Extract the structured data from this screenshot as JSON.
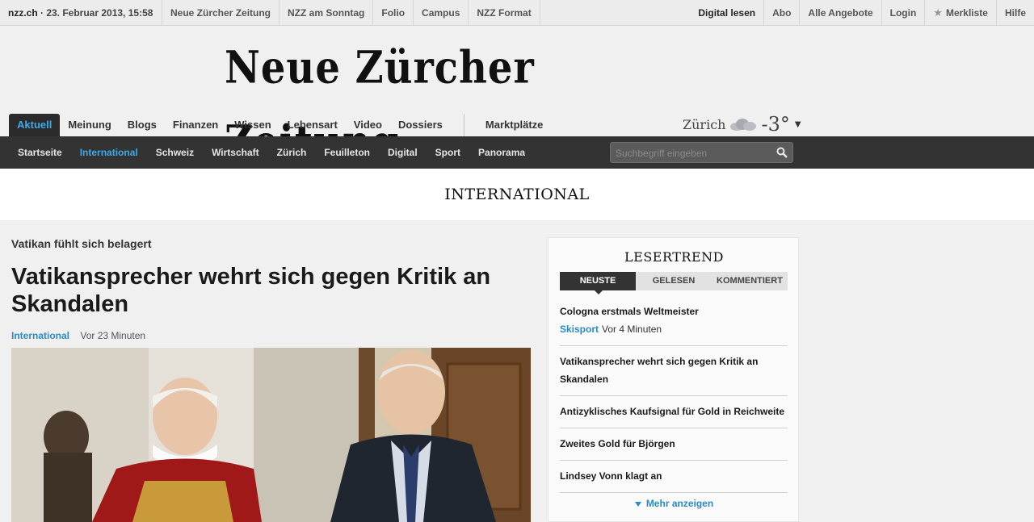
{
  "topbar": {
    "site": "nzz.ch",
    "date": " · 23. Februar 2013, 15:58",
    "links": [
      "Neue Zürcher Zeitung",
      "NZZ am Sonntag",
      "Folio",
      "Campus",
      "NZZ Format"
    ],
    "right_links": [
      "Digital lesen",
      "Abo",
      "Alle Angebote",
      "Login",
      "Merkliste",
      "Hilfe"
    ]
  },
  "logo": {
    "text": "Neue Zürcher Zeitung"
  },
  "primary_nav": {
    "items": [
      "Aktuell",
      "Meinung",
      "Blogs",
      "Finanzen",
      "Wissen",
      "Lebensart",
      "Video",
      "Dossiers"
    ],
    "extra": "Marktplätze"
  },
  "weather": {
    "city": "Zürich",
    "temp": "-3°",
    "icon": "cloud-icon"
  },
  "secondary_nav": {
    "items": [
      "Startseite",
      "International",
      "Schweiz",
      "Wirtschaft",
      "Zürich",
      "Feuilleton",
      "Digital",
      "Sport",
      "Panorama"
    ],
    "active": "International"
  },
  "search": {
    "placeholder": "Suchbegriff eingeben"
  },
  "section": {
    "title": "INTERNATIONAL"
  },
  "article": {
    "kicker": "Vatikan fühlt sich belagert",
    "headline": "Vatikansprecher wehrt sich gegen Kritik an Skandalen",
    "category": "International",
    "time": "Vor 23 Minuten"
  },
  "sidebar": {
    "title": "LESERTREND",
    "tabs": [
      "NEUSTE",
      "GELESEN",
      "KOMMENTIERT"
    ],
    "items": [
      {
        "title": "Cologna erstmals Weltmeister",
        "tag": "Skisport",
        "time": "Vor 4 Minuten"
      },
      {
        "title": "Vatikansprecher wehrt sich gegen Kritik an Skandalen"
      },
      {
        "title": "Antizyklisches Kaufsignal für Gold in Reichweite"
      },
      {
        "title": "Zweites Gold für Björgen"
      },
      {
        "title": "Lindsey Vonn klagt an"
      }
    ],
    "more": "Mehr anzeigen"
  },
  "colors": {
    "accent": "#2a8bc7",
    "nav_dark": "#333333",
    "active_tab": "#3fa9e6"
  }
}
